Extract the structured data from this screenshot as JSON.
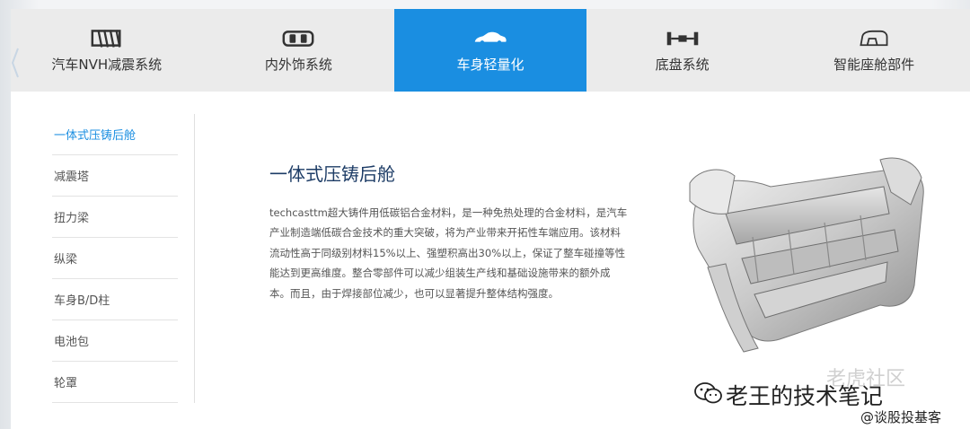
{
  "tabs": [
    {
      "label": "汽车NVH减震系统",
      "icon": "vibration-damper-icon"
    },
    {
      "label": "内外饰系统",
      "icon": "car-interior-icon"
    },
    {
      "label": "车身轻量化",
      "icon": "car-body-icon",
      "active": true
    },
    {
      "label": "底盘系统",
      "icon": "chassis-axle-icon"
    },
    {
      "label": "智能座舱部件",
      "icon": "smart-cockpit-icon"
    }
  ],
  "sidebar": {
    "items": [
      {
        "label": "一体式压铸后舱",
        "active": true
      },
      {
        "label": "减震塔"
      },
      {
        "label": "扭力梁"
      },
      {
        "label": "纵梁"
      },
      {
        "label": "车身B/D柱"
      },
      {
        "label": "电池包"
      },
      {
        "label": "轮罩"
      }
    ]
  },
  "content": {
    "title": "一体式压铸后舱",
    "body": "techcasttm超大铸件用低碳铝合金材料，是一种免热处理的合金材料，是汽车产业制造端低碳合金技术的重大突破，将为产业带来开拓性车端应用。该材料流动性高于同级别材料15%以上、强塑积高出30%以上，保证了整车碰撞等性能达到更高维度。整合零部件可以减少组装生产线和基础设施带来的额外成本。而且，由于焊接部位减少，也可以显著提升整体结构强度。"
  },
  "watermark": {
    "line1": "老王的技术笔记",
    "faint": "老虎社区",
    "line2": "@谈股投基客"
  },
  "colors": {
    "accent": "#1a8ee1",
    "tab_bg": "#ebebeb",
    "title": "#1d3c66"
  }
}
